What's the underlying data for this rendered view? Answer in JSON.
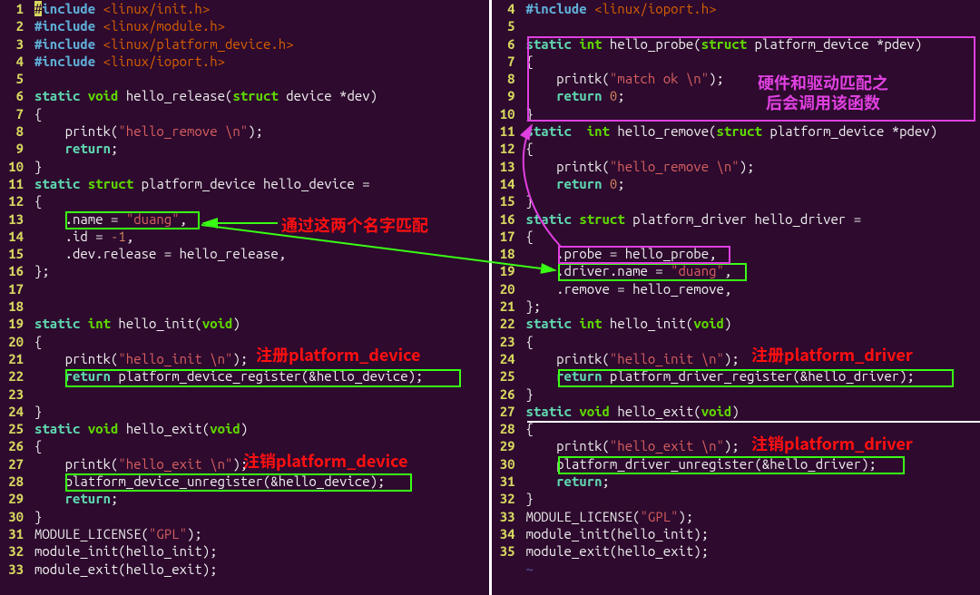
{
  "left": {
    "start": 1,
    "lines": [
      [
        [
          "cur",
          "#"
        ],
        [
          "pp",
          "include"
        ],
        [
          "id",
          " "
        ],
        [
          "ppid",
          "<linux/init.h>"
        ]
      ],
      [
        [
          "pp",
          "#include"
        ],
        [
          "id",
          " "
        ],
        [
          "ppid",
          "<linux/module.h>"
        ]
      ],
      [
        [
          "pp",
          "#include"
        ],
        [
          "id",
          " "
        ],
        [
          "ppid",
          "<linux/platform_device.h>"
        ]
      ],
      [
        [
          "pp",
          "#include"
        ],
        [
          "id",
          " "
        ],
        [
          "ppid",
          "<linux/ioport.h>"
        ]
      ],
      [
        [
          "id",
          ""
        ]
      ],
      [
        [
          "kw",
          "static"
        ],
        [
          "id",
          " "
        ],
        [
          "ty",
          "void"
        ],
        [
          "id",
          " hello_release("
        ],
        [
          "ty",
          "struct"
        ],
        [
          "id",
          " device *dev)"
        ]
      ],
      [
        [
          "id",
          "{"
        ]
      ],
      [
        [
          "id",
          "    printk("
        ],
        [
          "str",
          "\"hello_remove \\n\""
        ],
        [
          "id",
          ");"
        ]
      ],
      [
        [
          "id",
          "    "
        ],
        [
          "kw",
          "return"
        ],
        [
          "id",
          ";"
        ]
      ],
      [
        [
          "id",
          "}"
        ]
      ],
      [
        [
          "kw",
          "static"
        ],
        [
          "id",
          " "
        ],
        [
          "ty",
          "struct"
        ],
        [
          "id",
          " platform_device hello_device ="
        ]
      ],
      [
        [
          "id",
          "{"
        ]
      ],
      [
        [
          "id",
          "    .name = "
        ],
        [
          "str",
          "\"duang\""
        ],
        [
          "id",
          ","
        ]
      ],
      [
        [
          "id",
          "    .id = "
        ],
        [
          "num",
          "-1"
        ],
        [
          "id",
          ","
        ]
      ],
      [
        [
          "id",
          "    .dev.release = hello_release,"
        ]
      ],
      [
        [
          "id",
          "};"
        ]
      ],
      [
        [
          "id",
          ""
        ]
      ],
      [
        [
          "id",
          ""
        ]
      ],
      [
        [
          "kw",
          "static"
        ],
        [
          "id",
          " "
        ],
        [
          "ty",
          "int"
        ],
        [
          "id",
          " hello_init("
        ],
        [
          "ty",
          "void"
        ],
        [
          "id",
          ")"
        ]
      ],
      [
        [
          "id",
          "{"
        ]
      ],
      [
        [
          "id",
          "    printk("
        ],
        [
          "str",
          "\"hello_init \\n\""
        ],
        [
          "id",
          ");"
        ]
      ],
      [
        [
          "id",
          "    "
        ],
        [
          "kw",
          "return"
        ],
        [
          "id",
          " platform_device_register(&hello_device);"
        ]
      ],
      [
        [
          "id",
          ""
        ]
      ],
      [
        [
          "id",
          "}"
        ]
      ],
      [
        [
          "kw",
          "static"
        ],
        [
          "id",
          " "
        ],
        [
          "ty",
          "void"
        ],
        [
          "id",
          " hello_exit("
        ],
        [
          "ty",
          "void"
        ],
        [
          "id",
          ")"
        ]
      ],
      [
        [
          "id",
          "{"
        ]
      ],
      [
        [
          "id",
          "    printk("
        ],
        [
          "str",
          "\"hello_exit \\n\""
        ],
        [
          "id",
          ");"
        ]
      ],
      [
        [
          "id",
          "    platform_device_unregister(&hello_device);"
        ]
      ],
      [
        [
          "id",
          "    "
        ],
        [
          "kw",
          "return"
        ],
        [
          "id",
          ";"
        ]
      ],
      [
        [
          "id",
          "}"
        ]
      ],
      [
        [
          "id",
          "MODULE_LICENSE("
        ],
        [
          "str",
          "\"GPL\""
        ],
        [
          "id",
          ");"
        ]
      ],
      [
        [
          "id",
          "module_init(hello_init);"
        ]
      ],
      [
        [
          "id",
          "module_exit(hello_exit);"
        ]
      ]
    ]
  },
  "right": {
    "start": 4,
    "lines": [
      [
        [
          "pp",
          "#include"
        ],
        [
          "id",
          " "
        ],
        [
          "ppid",
          "<linux/ioport.h>"
        ]
      ],
      [
        [
          "id",
          ""
        ]
      ],
      [
        [
          "kw",
          "static"
        ],
        [
          "id",
          " "
        ],
        [
          "ty",
          "int"
        ],
        [
          "id",
          " hello_probe("
        ],
        [
          "ty",
          "struct"
        ],
        [
          "id",
          " platform_device *pdev)"
        ]
      ],
      [
        [
          "id",
          "{"
        ]
      ],
      [
        [
          "id",
          "    printk("
        ],
        [
          "str",
          "\"match ok \\n\""
        ],
        [
          "id",
          ");"
        ]
      ],
      [
        [
          "id",
          "    "
        ],
        [
          "kw",
          "return"
        ],
        [
          "id",
          " "
        ],
        [
          "num",
          "0"
        ],
        [
          "id",
          ";"
        ]
      ],
      [
        [
          "id",
          "}"
        ]
      ],
      [
        [
          "kw",
          "static"
        ],
        [
          "id",
          "  "
        ],
        [
          "ty",
          "int"
        ],
        [
          "id",
          " hello_remove("
        ],
        [
          "ty",
          "struct"
        ],
        [
          "id",
          " platform_device *pdev)"
        ]
      ],
      [
        [
          "id",
          "{"
        ]
      ],
      [
        [
          "id",
          "    printk("
        ],
        [
          "str",
          "\"hello_remove \\n\""
        ],
        [
          "id",
          ");"
        ]
      ],
      [
        [
          "id",
          "    "
        ],
        [
          "kw",
          "return"
        ],
        [
          "id",
          " "
        ],
        [
          "num",
          "0"
        ],
        [
          "id",
          ";"
        ]
      ],
      [
        [
          "id",
          "}"
        ]
      ],
      [
        [
          "kw",
          "static"
        ],
        [
          "id",
          " "
        ],
        [
          "ty",
          "struct"
        ],
        [
          "id",
          " platform_driver hello_driver ="
        ]
      ],
      [
        [
          "id",
          "{"
        ]
      ],
      [
        [
          "id",
          "    .probe = hello_probe,"
        ]
      ],
      [
        [
          "id",
          "    .driver.name = "
        ],
        [
          "str",
          "\"duang\""
        ],
        [
          "id",
          ","
        ]
      ],
      [
        [
          "id",
          "    .remove = hello_remove,"
        ]
      ],
      [
        [
          "id",
          "};"
        ]
      ],
      [
        [
          "kw",
          "static"
        ],
        [
          "id",
          " "
        ],
        [
          "ty",
          "int"
        ],
        [
          "id",
          " hello_init("
        ],
        [
          "ty",
          "void"
        ],
        [
          "id",
          ")"
        ]
      ],
      [
        [
          "id",
          "{"
        ]
      ],
      [
        [
          "id",
          "    printk("
        ],
        [
          "str",
          "\"hello_init \\n\""
        ],
        [
          "id",
          ");"
        ]
      ],
      [
        [
          "id",
          "    "
        ],
        [
          "kw",
          "return"
        ],
        [
          "id",
          " platform_driver_register(&hello_driver);"
        ]
      ],
      [
        [
          "id",
          "}"
        ]
      ],
      [
        [
          "kw",
          "static"
        ],
        [
          "id",
          " "
        ],
        [
          "ty",
          "void"
        ],
        [
          "id",
          " hello_exit("
        ],
        [
          "ty",
          "void"
        ],
        [
          "id",
          ")"
        ]
      ],
      [
        [
          "id",
          "{"
        ]
      ],
      [
        [
          "id",
          "    printk("
        ],
        [
          "str",
          "\"hello_exit \\n\""
        ],
        [
          "id",
          ");"
        ]
      ],
      [
        [
          "id",
          "    platform_driver_unregister(&hello_driver);"
        ]
      ],
      [
        [
          "id",
          "    "
        ],
        [
          "kw",
          "return"
        ],
        [
          "id",
          ";"
        ]
      ],
      [
        [
          "id",
          "}"
        ]
      ],
      [
        [
          "id",
          "MODULE_LICENSE("
        ],
        [
          "str",
          "\"GPL\""
        ],
        [
          "id",
          ");"
        ]
      ],
      [
        [
          "id",
          "module_init(hello_init);"
        ]
      ],
      [
        [
          "id",
          "module_exit(hello_exit);"
        ]
      ],
      [
        [
          "tilde",
          "~"
        ]
      ]
    ]
  },
  "annotations": {
    "match_name": "通过这两个名字匹配",
    "probe_note_l1": "硬件和驱动匹配之",
    "probe_note_l2": "后会调用该函数",
    "reg_device": "注册platform_device",
    "unreg_device": "注销platform_device",
    "reg_driver": "注册platform_driver",
    "unreg_driver": "注销platform_driver"
  }
}
